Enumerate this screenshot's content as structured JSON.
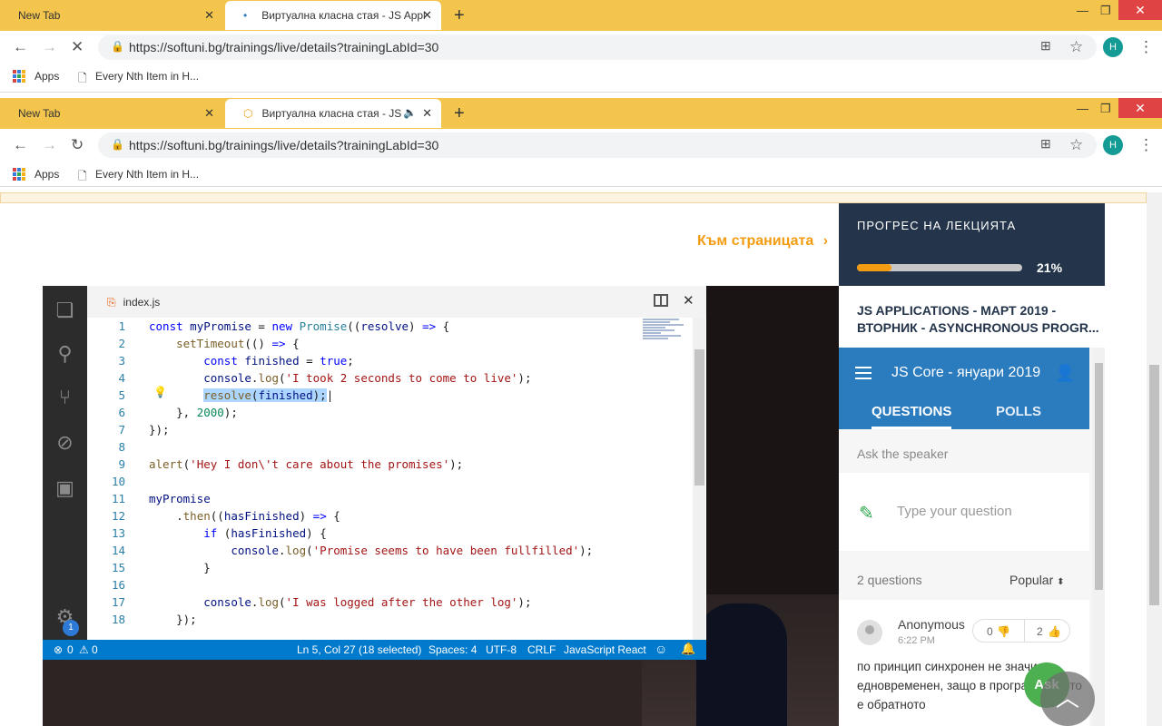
{
  "browser_back": {
    "tabs": [
      {
        "title": "New Tab"
      },
      {
        "title": "Виртуална класна стая - JS Appl"
      }
    ],
    "url": "https://softuni.bg/trainings/live/details?trainingLabId=30",
    "bookmarks": [
      "Apps",
      "Every Nth Item in H..."
    ],
    "avatar": "H"
  },
  "browser": {
    "tabs": [
      {
        "title": "New Tab"
      },
      {
        "title": "Виртуална класна стая - JS"
      }
    ],
    "url": "https://softuni.bg/trainings/live/details?trainingLabId=30",
    "bookmarks": [
      "Apps",
      "Every Nth Item in H..."
    ],
    "avatar": "H"
  },
  "page": {
    "goto_link": "Към страницата"
  },
  "vscode": {
    "filename": "index.js",
    "activity_badge": "1",
    "line_numbers": [
      "1",
      "2",
      "3",
      "4",
      "5",
      "6",
      "7",
      "8",
      "9",
      "10",
      "11",
      "12",
      "13",
      "14",
      "15",
      "16",
      "17",
      "18"
    ],
    "status": {
      "errors": "0",
      "warnings": "0",
      "cursor": "Ln 5, Col 27 (18 selected)",
      "spaces": "Spaces: 4",
      "encoding": "UTF-8",
      "eol": "CRLF",
      "language": "JavaScript React"
    }
  },
  "sidebar": {
    "progress_title": "ПРОГРЕС НА ЛЕКЦИЯТА",
    "progress_value": 0.21,
    "progress_label": "21%",
    "lecture_title": "JS APPLICATIONS - МАРТ 2019 - ВТОРНИК - ASYNCHRONOUS PROGR...",
    "widget": {
      "event_name": "JS Core - януари 2019",
      "tabs": [
        "QUESTIONS",
        "POLLS"
      ],
      "ask_label": "Ask the speaker",
      "question_placeholder": "Type your question",
      "count": "2 questions",
      "sort": "Popular",
      "question": {
        "author": "Anonymous",
        "time": "6:22 PM",
        "downvotes": "0",
        "upvotes": "2",
        "text": "по принцип синхронен не значи ли едновременен, защо в програмирането е обратното"
      },
      "ask_button": "Ask"
    }
  },
  "colors": {
    "tabstrip": "#f3c54c",
    "accent": "#f39c12",
    "vscode_status": "#007acc",
    "widget_header": "#2b7bbf",
    "progress_panel": "#23344b"
  }
}
